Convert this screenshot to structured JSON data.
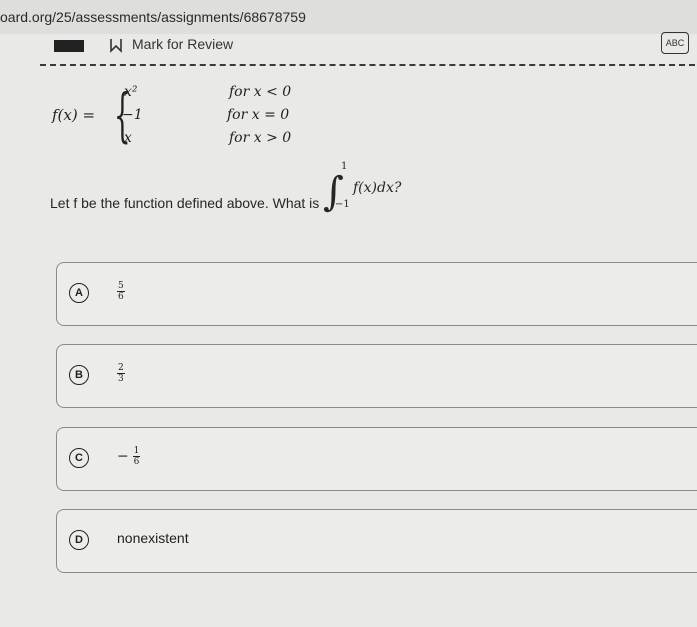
{
  "browser": {
    "url": "oard.org/25/assessments/assignments/68678759"
  },
  "toolbar": {
    "mark_label": "Mark for Review",
    "abc_label": "ABC"
  },
  "function": {
    "lhs": "f(x) =",
    "cases": [
      {
        "expr": "x²",
        "cond": "for x < 0"
      },
      {
        "expr": "−1",
        "cond": "for x = 0"
      },
      {
        "expr": "x",
        "cond": "for x > 0"
      }
    ]
  },
  "question": {
    "text": "Let f be the function defined above. What is",
    "integral_upper": "1",
    "integral_lower": "−1",
    "integrand": "f(x)dx?"
  },
  "choices": [
    {
      "letter": "A",
      "sign": "",
      "num": "5",
      "den": "6"
    },
    {
      "letter": "B",
      "sign": "",
      "num": "2",
      "den": "3"
    },
    {
      "letter": "C",
      "sign": "−",
      "num": "1",
      "den": "6"
    },
    {
      "letter": "D",
      "text": "nonexistent"
    }
  ]
}
